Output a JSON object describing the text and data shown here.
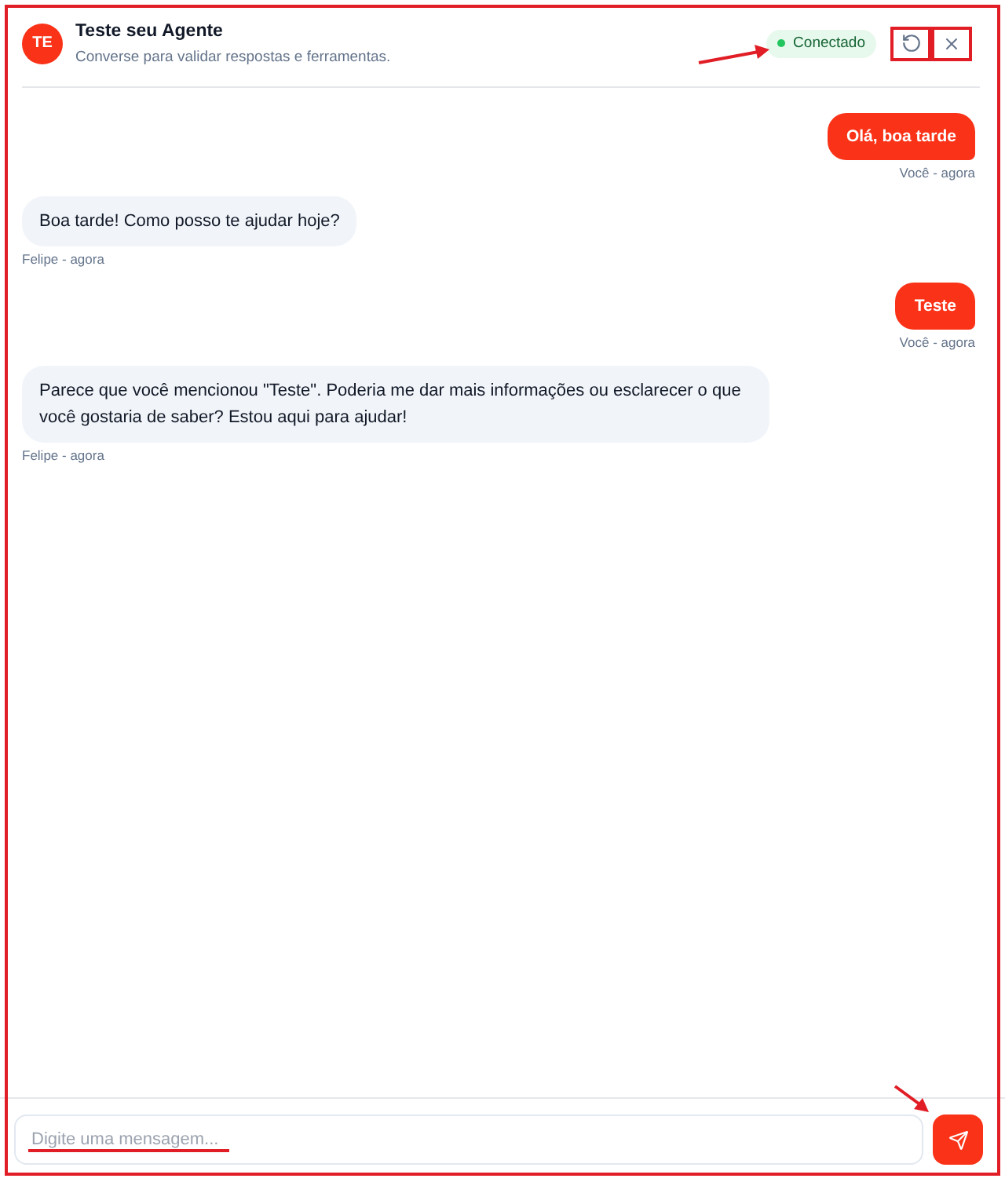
{
  "header": {
    "avatar": "TE",
    "title": "Teste seu Agente",
    "subtitle": "Converse para validar respostas e ferramentas.",
    "status": {
      "label": "Conectado",
      "connected": true
    }
  },
  "messages": [
    {
      "kind": "user",
      "text": "Olá, boa tarde",
      "meta": "Você - agora"
    },
    {
      "kind": "agent",
      "text": "Boa tarde! Como posso te ajudar hoje?",
      "meta": "Felipe - agora"
    },
    {
      "kind": "user",
      "text": "Teste",
      "meta": "Você - agora"
    },
    {
      "kind": "agent",
      "text": "Parece que você mencionou \"Teste\". Poderia me dar mais informações ou esclarecer o que você gostaria de saber? Estou aqui para ajudar!",
      "meta": "Felipe - agora"
    }
  ],
  "composer": {
    "placeholder": "Digite uma mensagem..."
  }
}
